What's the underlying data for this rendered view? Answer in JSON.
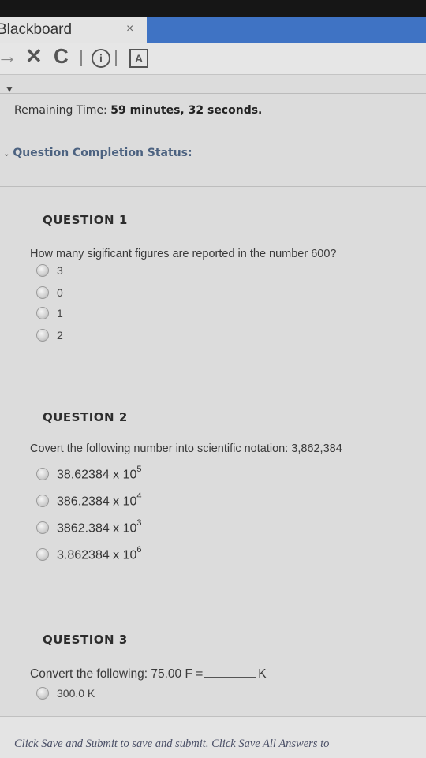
{
  "browser": {
    "tab_title": "Blackboard",
    "tab_close": "×",
    "back_glyph": "→",
    "close_glyph": "✕",
    "reload_glyph": "C",
    "info_glyph": "i",
    "extension_glyph": "A"
  },
  "timer": {
    "label": "Remaining Time:",
    "value": "59 minutes, 32 seconds."
  },
  "completion_status": {
    "label": "Question Completion Status:"
  },
  "questions": [
    {
      "title": "QUESTION 1",
      "text": "How many sigificant figures are reported in the number 600?",
      "options": [
        "3",
        "0",
        "1",
        "2"
      ]
    },
    {
      "title": "QUESTION 2",
      "text": "Covert the following number into scientific notation: 3,862,384",
      "options": [
        {
          "base": "38.62384 x 10",
          "exp": "5"
        },
        {
          "base": "386.2384 x 10",
          "exp": "4"
        },
        {
          "base": "3862.384 x 10",
          "exp": "3"
        },
        {
          "base": "3.862384 x 10",
          "exp": "6"
        }
      ]
    },
    {
      "title": "QUESTION 3",
      "text_before": "Convert the following: 75.00 F =",
      "text_after": "K",
      "options": [
        "300.0 K"
      ]
    }
  ],
  "footer": {
    "text": "Click Save and Submit to save and submit. Click Save All Answers to"
  }
}
